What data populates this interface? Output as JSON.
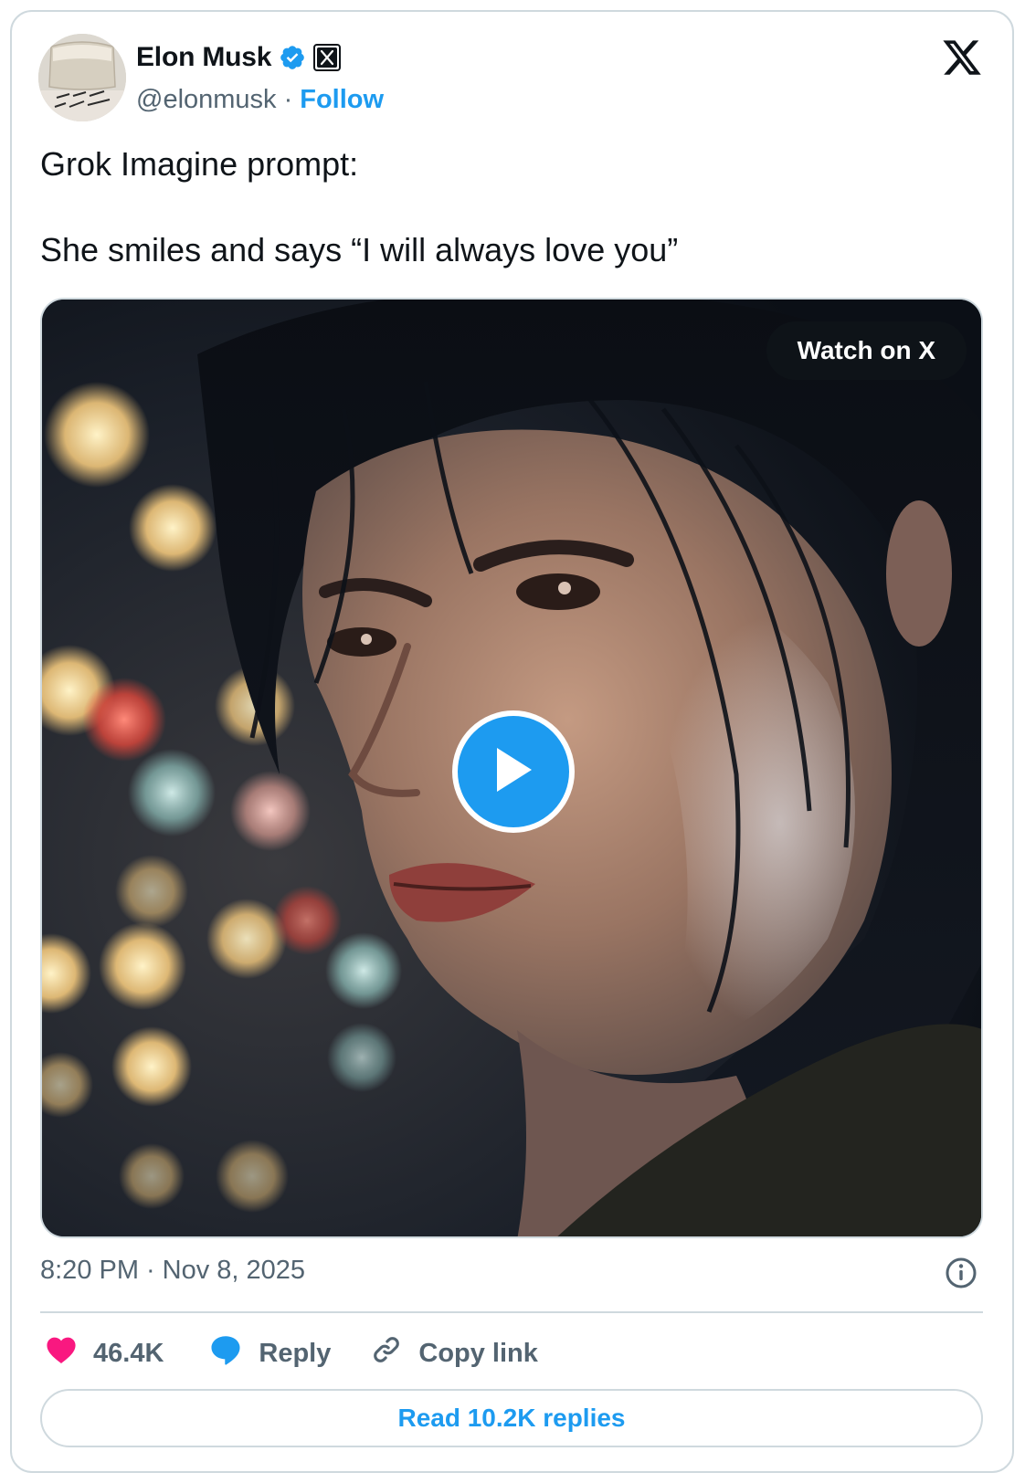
{
  "author": {
    "name": "Elon Musk",
    "handle": "@elonmusk",
    "separator": "·",
    "follow_label": "Follow"
  },
  "tweet": {
    "lines": [
      "Grok Imagine prompt:",
      "She smiles and says “I will always love you”"
    ]
  },
  "media": {
    "watch_label": "Watch on X"
  },
  "meta": {
    "time": "8:20 PM",
    "separator": "·",
    "date": "Nov 8, 2025"
  },
  "actions": {
    "likes": "46.4K",
    "reply_label": "Reply",
    "copy_label": "Copy link"
  },
  "read_replies_label": "Read 10.2K replies",
  "colors": {
    "accent": "#1d9bf0",
    "like": "#f91880",
    "text": "#0f1419",
    "muted": "#536471",
    "border": "#cfd9de"
  },
  "icons": [
    "verified-icon",
    "x-affiliate-badge-icon",
    "x-logo-icon",
    "play-icon",
    "info-icon",
    "heart-icon",
    "reply-bubble-icon",
    "link-icon"
  ]
}
